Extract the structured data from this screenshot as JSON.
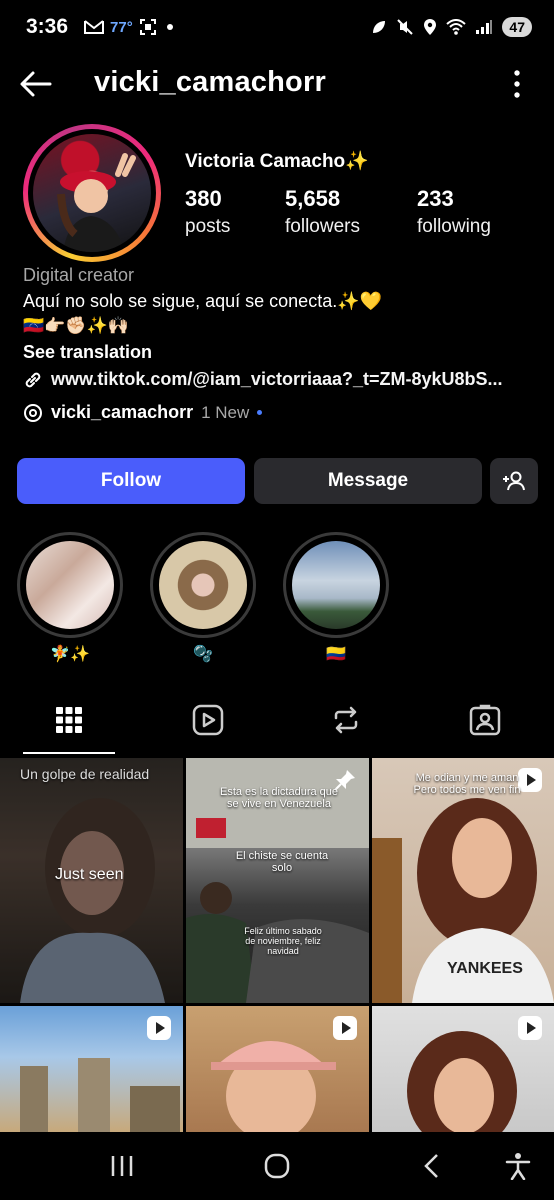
{
  "status_bar": {
    "time": "3:36",
    "temperature": "77°",
    "battery": "47"
  },
  "header": {
    "username": "vicki_camachorr",
    "icons": [
      "back-arrow-icon",
      "more-vertical-icon"
    ]
  },
  "profile": {
    "display_name": "Victoria Camacho✨",
    "stats": [
      {
        "value": "380",
        "label": "posts"
      },
      {
        "value": "5,658",
        "label": "followers"
      },
      {
        "value": "233",
        "label": "following"
      }
    ],
    "category": "Digital creator",
    "bio_line": "Aquí no solo se sigue, aquí se conecta.✨💛",
    "bio_emojis": "🇻🇪👉🏻✊🏻✨🙌🏻",
    "see_translation": "See translation",
    "link": "www.tiktok.com/@iam_victorriaaa?_t=ZM-8ykU8bS...",
    "threads_name": "vicki_camachorr",
    "threads_badge": "1 New"
  },
  "actions": {
    "follow": "Follow",
    "message": "Message"
  },
  "highlights": [
    {
      "label": "🧚✨"
    },
    {
      "label": "🫧"
    },
    {
      "label": "🇨🇴"
    }
  ],
  "tabs": [
    "grid-icon",
    "reels-icon",
    "reposts-icon",
    "tagged-icon"
  ],
  "posts": [
    {
      "text_top": "Un golpe de realidad",
      "text_mid": "Just seen"
    },
    {
      "text_top": "Esta es la dictadura que se vive en Venezuela",
      "text_mid": "El chiste se cuenta solo",
      "text_low": "Feliz último sabado de noviembre, feliz navidad"
    },
    {
      "text_top": "Me odian y me aman Pero todos me ven fin"
    },
    {},
    {},
    {}
  ],
  "colors": {
    "follow_button": "#4a5dfb",
    "secondary_button": "#2a2a2e",
    "background": "#000000"
  }
}
